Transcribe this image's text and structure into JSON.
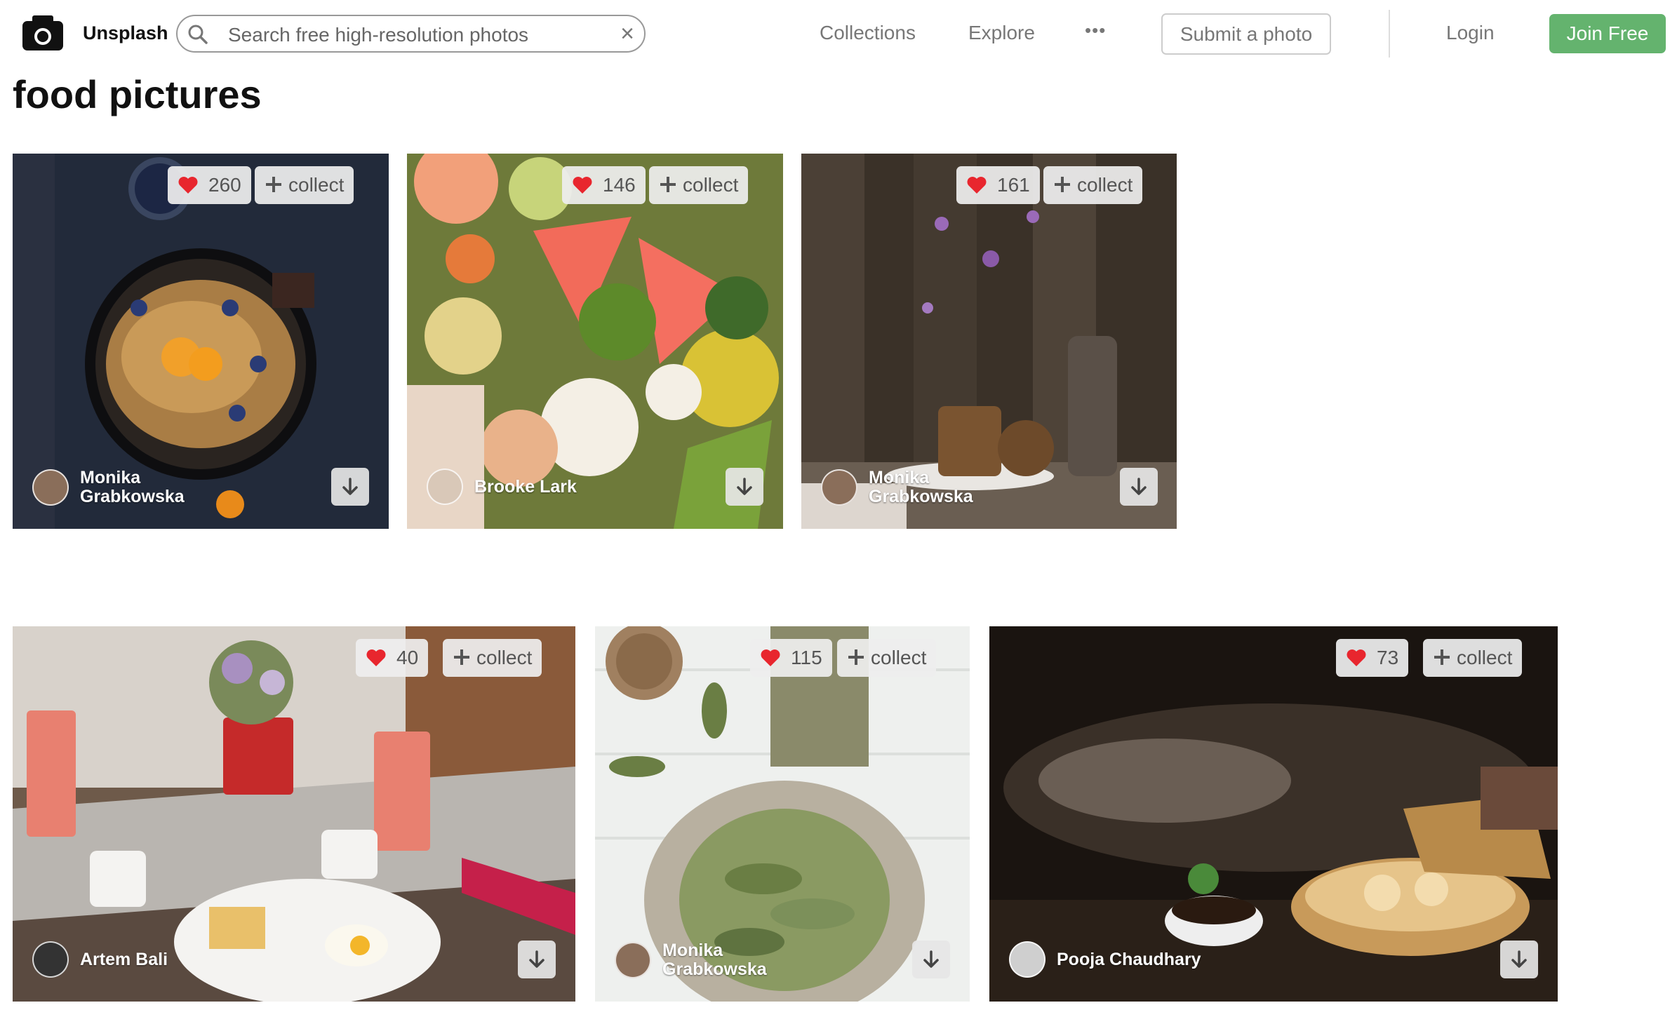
{
  "header": {
    "brand": "Unsplash",
    "search_placeholder": "Search free high-resolution photos",
    "clear": "×",
    "nav": {
      "collections": "Collections",
      "explore": "Explore",
      "more": "•••"
    },
    "submit": "Submit a photo",
    "login": "Login",
    "join": "Join Free"
  },
  "page_title": "food pictures",
  "photos": [
    {
      "likes": "260",
      "collect": "collect",
      "author": "Monika Grabkowska"
    },
    {
      "likes": "146",
      "collect": "collect",
      "author": "Brooke Lark"
    },
    {
      "likes": "161",
      "collect": "collect",
      "author": "Monika Grabkowska"
    },
    {
      "likes": "40",
      "collect": "collect",
      "author": "Artem Bali"
    },
    {
      "likes": "115",
      "collect": "collect",
      "author": "Monika Grabkowska"
    },
    {
      "likes": "73",
      "collect": "collect",
      "author": "Pooja Chaudhary"
    }
  ],
  "colors": {
    "join": "#64b36e",
    "heart": "#e8262e"
  }
}
